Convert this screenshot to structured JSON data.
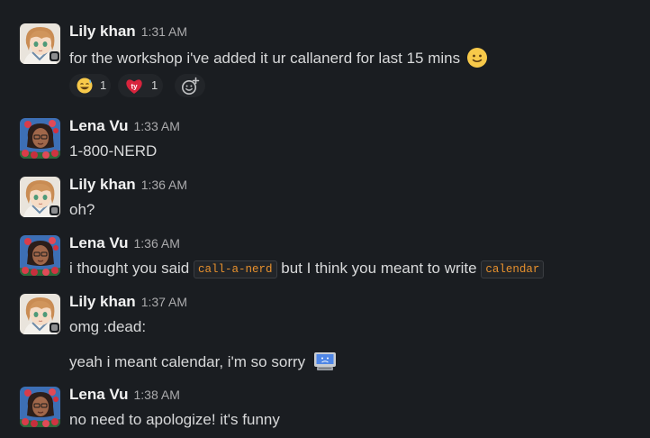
{
  "messages": [
    {
      "author": "Lily khan",
      "time": "1:31 AM",
      "text": "for the workshop i've added it ur callanerd for last 15 mins",
      "emoji": "slightly-smiling-face-emoji",
      "reactions": [
        {
          "emoji": "sweat-smile-emoji",
          "count": "1"
        },
        {
          "emoji": "ty-heart-emoji",
          "count": "1"
        }
      ],
      "add_reaction_icon": "add-reaction-icon"
    },
    {
      "author": "Lena Vu",
      "time": "1:33 AM",
      "text": "1-800-NERD"
    },
    {
      "author": "Lily khan",
      "time": "1:36 AM",
      "text": "oh?"
    },
    {
      "author": "Lena Vu",
      "time": "1:36 AM",
      "text_before": "i thought you said",
      "code_1": "call-a-nerd",
      "text_middle": "but I think you meant to write",
      "code_2": "calendar"
    },
    {
      "author": "Lily khan",
      "time": "1:37 AM",
      "text": "omg :dead:",
      "followup": "yeah i meant calendar, i'm so sorry",
      "followup_emoji": "sad-computer-emoji"
    },
    {
      "author": "Lena Vu",
      "time": "1:38 AM",
      "text": "no need to apologize! it's funny"
    }
  ],
  "colors": {
    "background": "#1a1d21",
    "author": "#f2f2f2",
    "timestamp": "#ababad",
    "code_text": "#e8912d",
    "presence_away": "#8c8d8f"
  }
}
